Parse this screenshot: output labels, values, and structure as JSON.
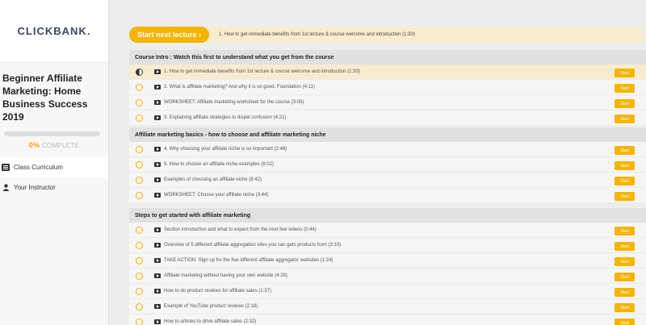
{
  "sidebar": {
    "logo": "CLICKBANK.",
    "course_title": "Beginner Affiliate Marketing: Home Business Success 2019",
    "progress_percent": "0%",
    "progress_label": "COMPLETE",
    "progress_value": 0,
    "nav": [
      {
        "label": "Class Curriculum",
        "icon": "list-icon"
      },
      {
        "label": "Your Instructor",
        "icon": "user-icon"
      }
    ]
  },
  "next_lecture": {
    "button_label": "Start next lecture ›",
    "text": "1. How to get immediate benefits from 1st lecture & course welcome and introduction (1:30)"
  },
  "sections": [
    {
      "title": "Course Intro : Watch this first to understand what you get from the course",
      "lectures": [
        {
          "title": "1. How to get immediate benefits from 1st lecture & course welcome and introduction (1:30)",
          "start": "Start",
          "current": true
        },
        {
          "title": "2. What is affiliate marketing? And why it is so good. Foundation (4:11)",
          "start": "Start"
        },
        {
          "title": "WORKSHEET: Affiliate marketing worksheet for the course (3:08)",
          "start": "Start"
        },
        {
          "title": "3. Explaining affiliate strategies to dispel confusion (4:21)",
          "start": "Start"
        }
      ]
    },
    {
      "title": "Affiliate marketing basics - how to choose and affiliate marketing niche",
      "lectures": [
        {
          "title": "4. Why choosing your affiliate niche is so important (2:48)",
          "start": "Start"
        },
        {
          "title": "5. How to choose an affiliate niche examples (8:02)",
          "start": "Start"
        },
        {
          "title": "Examples of choosing an affiliate niche (8:42)",
          "start": "Start"
        },
        {
          "title": "WORKSHEET: Choose your affiliate niche (3:44)",
          "start": "Start"
        }
      ]
    },
    {
      "title": "Steps to get started with affiliate marketing",
      "lectures": [
        {
          "title": "Section introduction and what to expect from the next few videos (0:44)",
          "start": "Start"
        },
        {
          "title": "Overview of 5 different affiliate aggregation sites you can gets products from (3:10)",
          "start": "Start"
        },
        {
          "title": "TAKE ACTION: Sign up for the five different affiliate aggregator websites (1:24)",
          "start": "Start"
        },
        {
          "title": "Affiliate marketing without having your own website (4:28)",
          "start": "Start"
        },
        {
          "title": "How to do product reviews for affiliate sales (1:37)",
          "start": "Start"
        },
        {
          "title": "Example of YouTube product reviews (2:18)",
          "start": "Start"
        },
        {
          "title": "How to articles to drive affiliate sales (2:32)",
          "start": "Start"
        }
      ]
    }
  ],
  "colors": {
    "accent": "#f4b400",
    "current_row": "#f8ecd0",
    "section_header": "#e1e1e1"
  }
}
